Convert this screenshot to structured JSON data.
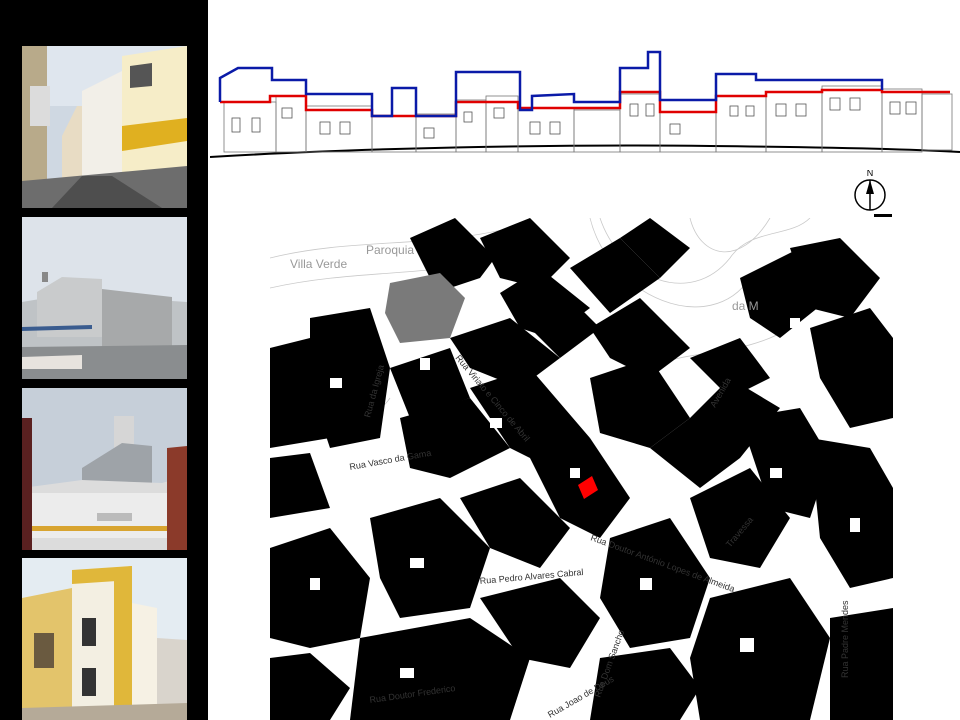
{
  "map": {
    "north_label": "N",
    "colors": {
      "background": "#ffffff",
      "side_bar": "#000000",
      "building_fill": "#000000",
      "church_fill": "#7a7a7a",
      "highlight_plot": "#ff0000",
      "elevation_original": "#e00000",
      "elevation_proposed": "#0a1aa8"
    },
    "place_labels": [
      "Paroquia",
      "Villa Verde",
      "da M"
    ],
    "street_labels": [
      "Rua da Igreja",
      "Rua Vasco da Gama",
      "Rua Viriato e Cinco de Abril",
      "Rua Doutor António Lopes de Almeida",
      "Rua Pedro Alvares Cabral",
      "Rua Dom Sancho",
      "Rua Padre Mendes",
      "Rua Doutor Frederico",
      "Rua Joao de Deus",
      "Avenida",
      "Travessa"
    ],
    "photos": [
      {
        "icon": "street-photo-icon",
        "label": "Street view"
      },
      {
        "icon": "rooftop-photo-icon",
        "label": "Rooftops"
      },
      {
        "icon": "terrace-photo-icon",
        "label": "Roof terrace"
      },
      {
        "icon": "yellow-house-photo-icon",
        "label": "Corner house"
      }
    ]
  }
}
